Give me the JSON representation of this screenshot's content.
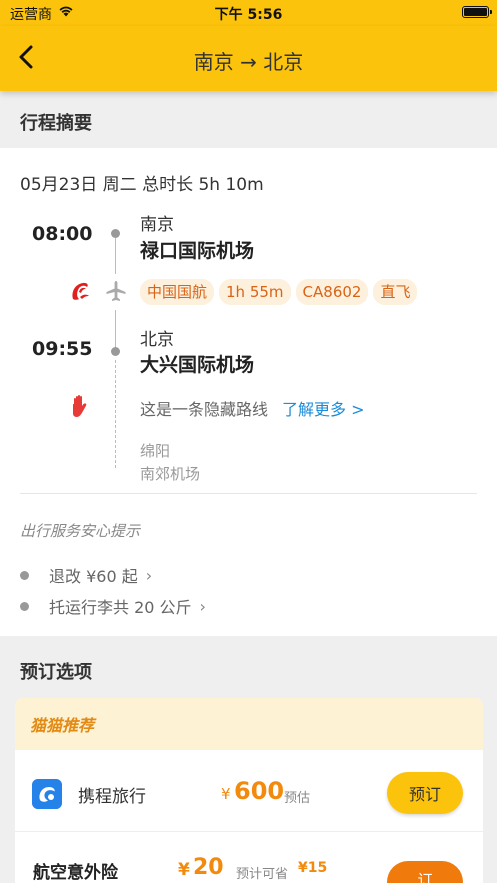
{
  "status_bar": {
    "carrier": "运营商",
    "time": "下午 5:56"
  },
  "nav": {
    "title": "南京 → 北京"
  },
  "summary_section": {
    "heading": "行程摘要",
    "date_line": "05月23日 周二 总时长 5h 10m",
    "departure": {
      "time": "08:00",
      "city": "南京",
      "airport": "禄口国际机场"
    },
    "flight_tags": [
      "中国国航",
      "1h 55m",
      "CA8602",
      "直飞"
    ],
    "arrival": {
      "time": "09:55",
      "city": "北京",
      "airport": "大兴国际机场"
    },
    "hidden_route_text": "这是一条隐藏路线",
    "learn_more": "了解更多 >",
    "hidden_stop": {
      "city": "绵阳",
      "airport": "南郊机场"
    },
    "tips_title": "出行服务安心提示",
    "tips": [
      "退改 ¥60 起",
      "托运行李共 20 公斤"
    ]
  },
  "booking_section": {
    "heading": "预订选项",
    "recommend_label": "猫猫推荐",
    "vendor_row": {
      "vendor": "携程旅行",
      "currency": "¥",
      "price": "600",
      "price_note": "预估",
      "button": "预订"
    },
    "insurance_row": {
      "name": "航空意外险",
      "currency": "¥",
      "price": "20",
      "save_note": "预计可省",
      "save_amount": "¥15",
      "button": "订"
    }
  },
  "colors": {
    "brand_yellow": "#fcc30c",
    "price_orange": "#f28a0d",
    "link_blue": "#1a8cd8",
    "airline_red": "#e02020"
  },
  "icons": [
    "back-chevron-icon",
    "wifi-icon",
    "battery-icon",
    "air-china-logo-icon",
    "plane-icon",
    "hand-stop-icon",
    "chevron-right-icon",
    "ctrip-logo-icon"
  ]
}
